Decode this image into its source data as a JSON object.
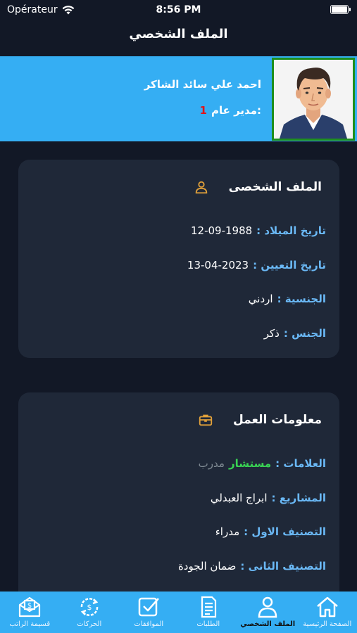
{
  "status_bar": {
    "carrier": "Opérateur",
    "time": "8:56 PM"
  },
  "nav": {
    "title": "الملف الشخصي"
  },
  "profile": {
    "name": "احمد علي سائد الشاكر",
    "role_number": "1",
    "role": ":مدير عام"
  },
  "personal_card": {
    "title": "الملف الشخصى",
    "icon": "user-icon",
    "rows": [
      {
        "label": "تاريخ الميلاد :",
        "value": "12-09-1988"
      },
      {
        "label": "تاريخ التعيين :",
        "value": "13-04-2023"
      },
      {
        "label": "الجنسية :",
        "value": "اردني"
      },
      {
        "label": "الجنس :",
        "value": "ذكر"
      }
    ]
  },
  "work_card": {
    "title": "معلومات العمل",
    "icon": "briefcase-icon",
    "marks_label": "العلامات :",
    "marks_value": "مستشار",
    "marks_extra": "مدرب",
    "rows": [
      {
        "label": "المشاريع :",
        "value": "ابراج العبدلي"
      },
      {
        "label": "التصنيف الاول :",
        "value": "مدراء"
      },
      {
        "label": "التصنيف الثانى :",
        "value": "ضمان الجودة"
      }
    ]
  },
  "tabs": [
    {
      "label": "الصفحة الرئيسية",
      "icon": "home-icon",
      "active": false
    },
    {
      "label": "الملف الشخصي",
      "icon": "person-icon",
      "active": true
    },
    {
      "label": "الطلبات",
      "icon": "document-icon",
      "active": false
    },
    {
      "label": "الموافقات",
      "icon": "checkbox-icon",
      "active": false
    },
    {
      "label": "الحركات",
      "icon": "exchange-icon",
      "active": false
    },
    {
      "label": "قسيمة الراتب",
      "icon": "payslip-icon",
      "active": false
    }
  ],
  "colors": {
    "banner": "#35aef3",
    "card": "#1f2838",
    "background": "#121826",
    "label": "#6ab8f5",
    "accent_icon": "#e0a03a"
  }
}
